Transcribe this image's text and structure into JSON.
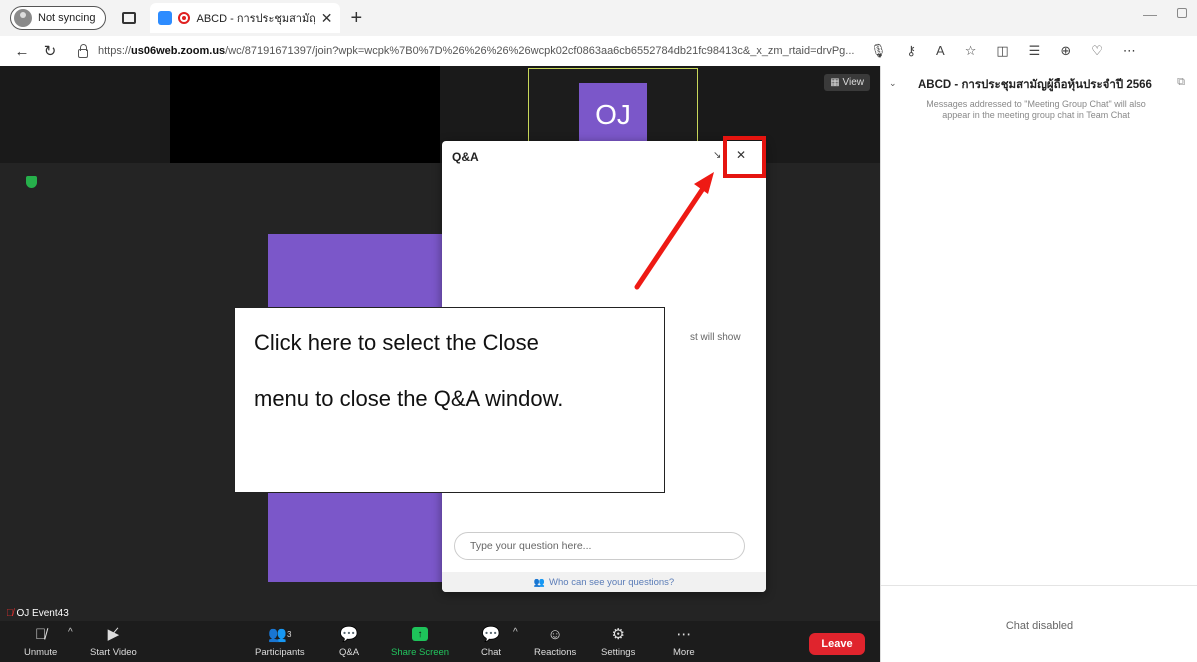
{
  "browser": {
    "profile_label": "Not syncing",
    "tab_title": "ABCD - การประชุมสามัญผู้ถือา",
    "url_prefix": "https://",
    "url_host": "us06web.zoom.us",
    "url_rest": "/wc/87191671397/join?wpk=wcpk%7B0%7D%26%26%26%26wcpk02cf0863aa6cb6552784db21fc98413c&_x_zm_rtaid=drvPg..."
  },
  "meeting": {
    "view_label": "View",
    "tile_initials": "OJ",
    "participant_name": "OJ Event43",
    "participants_count": "3"
  },
  "toolbar": {
    "unmute": "Unmute",
    "start_video": "Start Video",
    "participants": "Participants",
    "qa": "Q&A",
    "share_screen": "Share Screen",
    "chat": "Chat",
    "reactions": "Reactions",
    "settings": "Settings",
    "more": "More",
    "leave": "Leave"
  },
  "qa_dialog": {
    "title": "Q&A",
    "empty_text": "st will show",
    "input_placeholder": "Type your question here...",
    "footer": "Who can see your questions?"
  },
  "annotation": {
    "line1": "Click here to select the Close",
    "line2": "menu to close the Q&A window."
  },
  "chat_panel": {
    "title": "ABCD - การประชุมสามัญผู้ถือหุ้นประจำปี 2566",
    "note": "Messages addressed to \"Meeting Group Chat\" will also appear in the meeting group chat in Team Chat",
    "disabled": "Chat disabled"
  },
  "colors": {
    "avatar": "#7b57c9",
    "highlight": "#e5140f",
    "leave": "#e0242d",
    "share": "#1ec35a"
  }
}
